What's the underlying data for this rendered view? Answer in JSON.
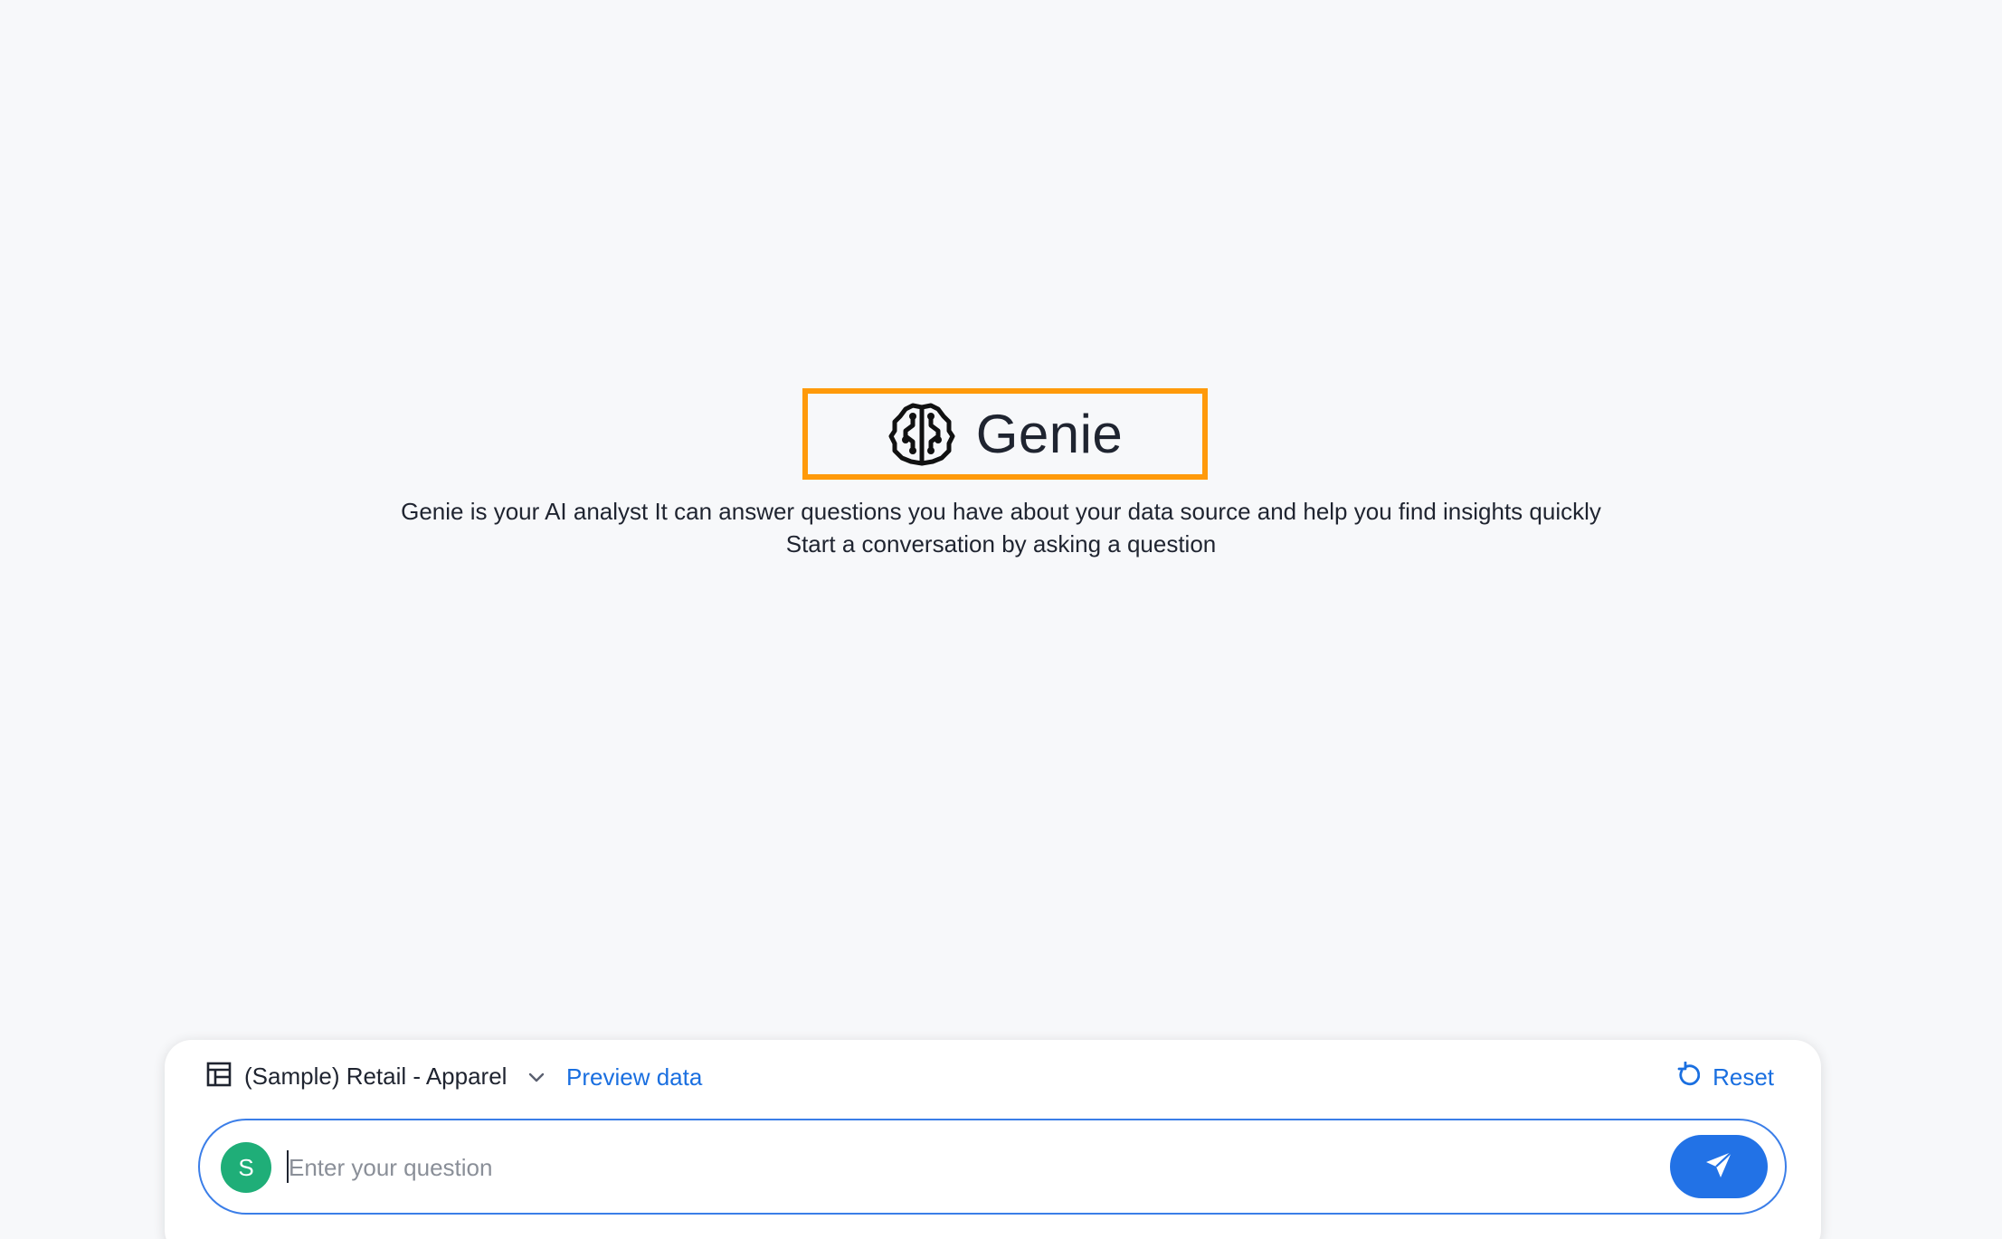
{
  "hero": {
    "title": "Genie",
    "logo_icon": "brain-icon",
    "tagline_line1": "Genie is your AI analyst It can answer questions you have about your data source and help you find insights quickly",
    "tagline_line2": "Start a conversation by asking a question",
    "highlight_color": "#ff9a0a"
  },
  "composer": {
    "data_source_icon": "table-icon",
    "data_source_label": "(Sample) Retail - Apparel",
    "dropdown_icon": "chevron-down-icon",
    "preview_link": "Preview data",
    "reset_icon": "reset-icon",
    "reset_label": "Reset",
    "avatar_initial": "S",
    "avatar_color": "#1fae78",
    "input_placeholder": "Enter your question",
    "input_value": "",
    "send_icon": "send-icon",
    "accent_color": "#2272e6"
  }
}
